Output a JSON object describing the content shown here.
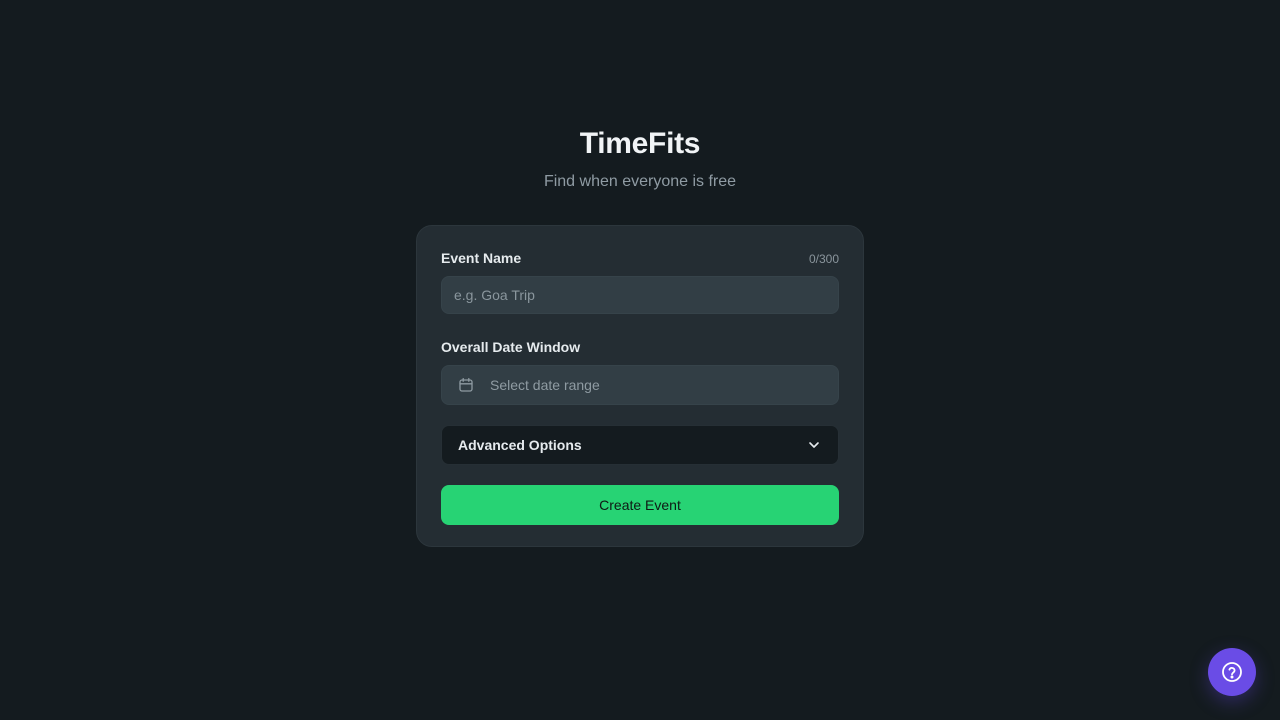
{
  "app": {
    "title": "TimeFits",
    "subtitle": "Find when everyone is free"
  },
  "form": {
    "event_name": {
      "label": "Event Name",
      "counter": "0/300",
      "value": "",
      "placeholder": "e.g. Goa Trip"
    },
    "date_window": {
      "label": "Overall Date Window",
      "placeholder": "Select date range",
      "icon": "calendar-icon"
    },
    "advanced": {
      "label": "Advanced Options",
      "icon": "chevron-down-icon"
    },
    "submit_label": "Create Event"
  },
  "help": {
    "icon": "help-circle-icon"
  },
  "colors": {
    "background": "#141b1f",
    "card": "#242d33",
    "input": "#323e45",
    "accent": "#27d374",
    "help_button": "#6a4ce6"
  }
}
